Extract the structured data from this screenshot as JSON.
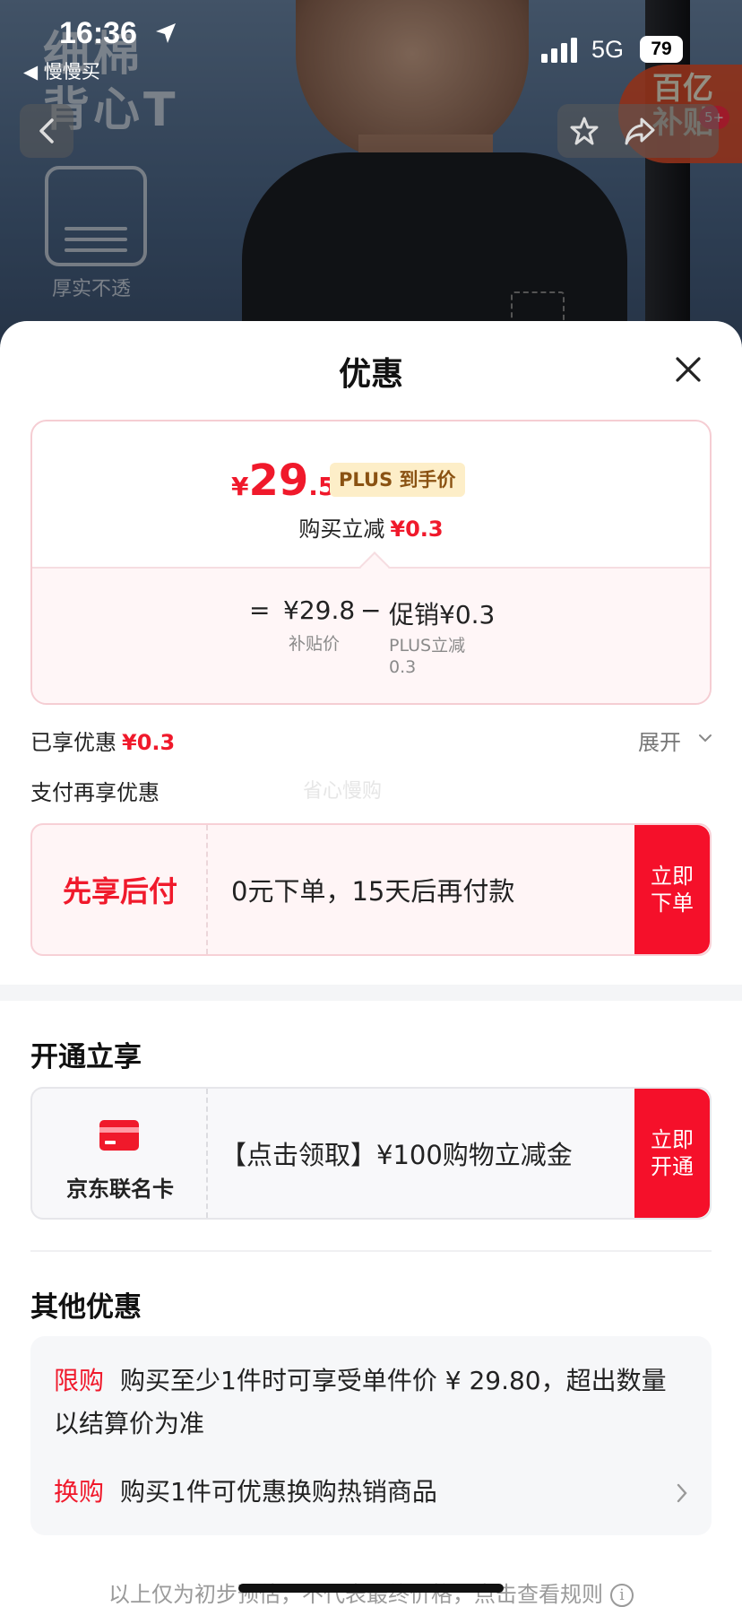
{
  "status_bar": {
    "time": "16:36",
    "back_app": "◀ 慢慢买",
    "network": "5G",
    "battery": "79"
  },
  "product_banner": {
    "title_line1": "细棉",
    "title_line2": "背心T",
    "feature_label": "厚实不透",
    "subsidy_badge_line1": "百亿",
    "subsidy_badge_line2": "补贴",
    "cart_count": "5+"
  },
  "sheet": {
    "title": "优惠",
    "price": {
      "currency": "¥",
      "integer": "29",
      "decimal": ".5",
      "plus_tag": "PLUS 到手价",
      "reduce_label": "购买立减",
      "reduce_value": "¥0.3",
      "formula_eq": "=",
      "formula_base": "¥29.8",
      "formula_base_label": "补贴价",
      "formula_minus": "−",
      "formula_promo": "促销¥0.3",
      "formula_promo_label_1": "PLUS立减",
      "formula_promo_label_2": "0.3"
    },
    "enjoyed_label": "已享优惠",
    "enjoyed_value": "¥0.3",
    "expand_label": "展开",
    "pay_more_label": "支付再享优惠",
    "watermark": "省心慢购",
    "bnpl": {
      "label": "先享后付",
      "text": "0元下单，15天后再付款",
      "cta_line1": "立即",
      "cta_line2": "下单"
    },
    "open_section_title": "开通立享",
    "card_offer": {
      "name": "京东联名卡",
      "text": "【点击领取】¥100购物立减金",
      "cta_line1": "立即",
      "cta_line2": "开通"
    },
    "other_section_title": "其他优惠",
    "other": [
      {
        "tag": "限购",
        "text": "购买至少1件时可享受单件价 ¥ 29.80，超出数量以结算价为准"
      },
      {
        "tag": "换购",
        "text": "购买1件可优惠换购热销商品"
      }
    ],
    "footer_note": "以上仅为初步预估，不代表最终价格，点击查看规则"
  },
  "colors": {
    "accent_red": "#f0192b",
    "cta_red": "#f5102a",
    "plus_tag_bg": "#fdeec8",
    "plus_tag_text": "#8a5212"
  }
}
